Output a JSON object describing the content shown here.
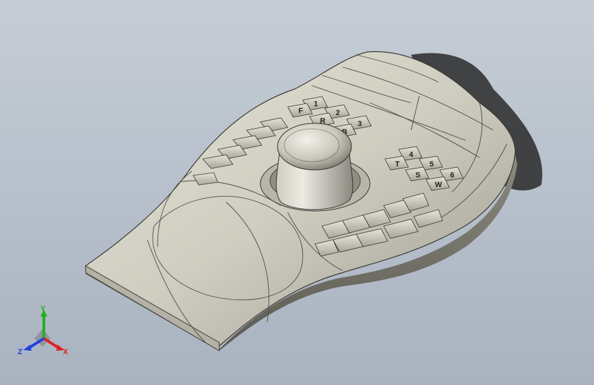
{
  "viewport": {
    "background_top": "#c6cdd6",
    "background_bottom": "#a9b3c0",
    "model_color": "#d2d0c2"
  },
  "keys": {
    "numbers": [
      "1",
      "2",
      "3"
    ],
    "f_row": [
      "F",
      "R",
      "B"
    ],
    "view_numbers": [
      "4",
      "5",
      "6"
    ],
    "view_letters": [
      "T",
      "S",
      "W"
    ]
  },
  "triad": {
    "x_label": "X",
    "y_label": "Y",
    "z_label": "Z",
    "x_color": "#e02020",
    "y_color": "#20b020",
    "z_color": "#2040e0"
  }
}
